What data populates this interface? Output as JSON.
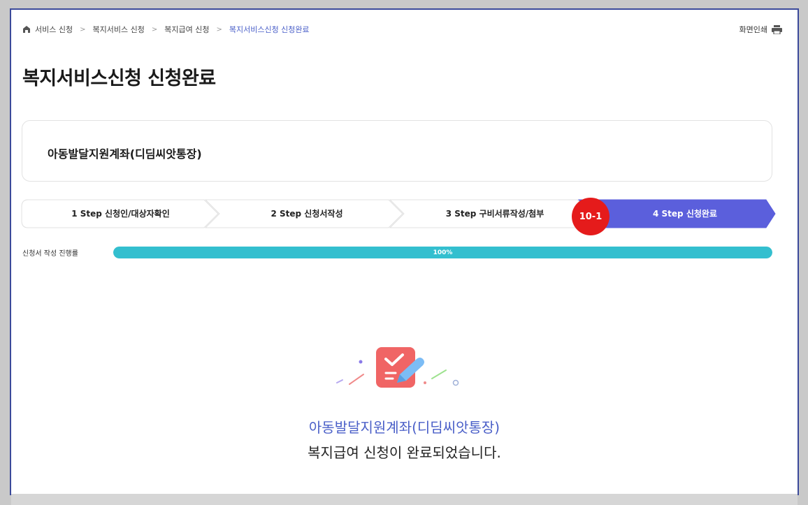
{
  "breadcrumb": {
    "items": [
      "서비스 신청",
      "복지서비스 신청",
      "복지급여 신청",
      "복지서비스신청 신청완료"
    ]
  },
  "print": {
    "label": "화면인쇄"
  },
  "page_title": "복지서비스신청 신청완료",
  "service": {
    "name": "아동발달지원계좌(디딤씨앗통장)"
  },
  "steps": [
    {
      "label": "1 Step 신청인/대상자확인",
      "active": false
    },
    {
      "label": "2 Step 신청서작성",
      "active": false
    },
    {
      "label": "3 Step 구비서류작성/첨부",
      "active": false
    },
    {
      "label": "4 Step 신청완료",
      "active": true
    }
  ],
  "badge": {
    "text": "10-1",
    "color": "#e51b1b"
  },
  "progress": {
    "label": "신청서 작성 진행률",
    "value_text": "100%",
    "value": 1.0,
    "color": "#33bfcf"
  },
  "completion": {
    "service_name": "아동발달지원계좌(디딤씨앗통장)",
    "message": "복지급여 신청이 완료되었습니다."
  },
  "colors": {
    "accent": "#4a5fc8",
    "active_step": "#5b5fdc",
    "frame_border": "#3b4a9a"
  }
}
